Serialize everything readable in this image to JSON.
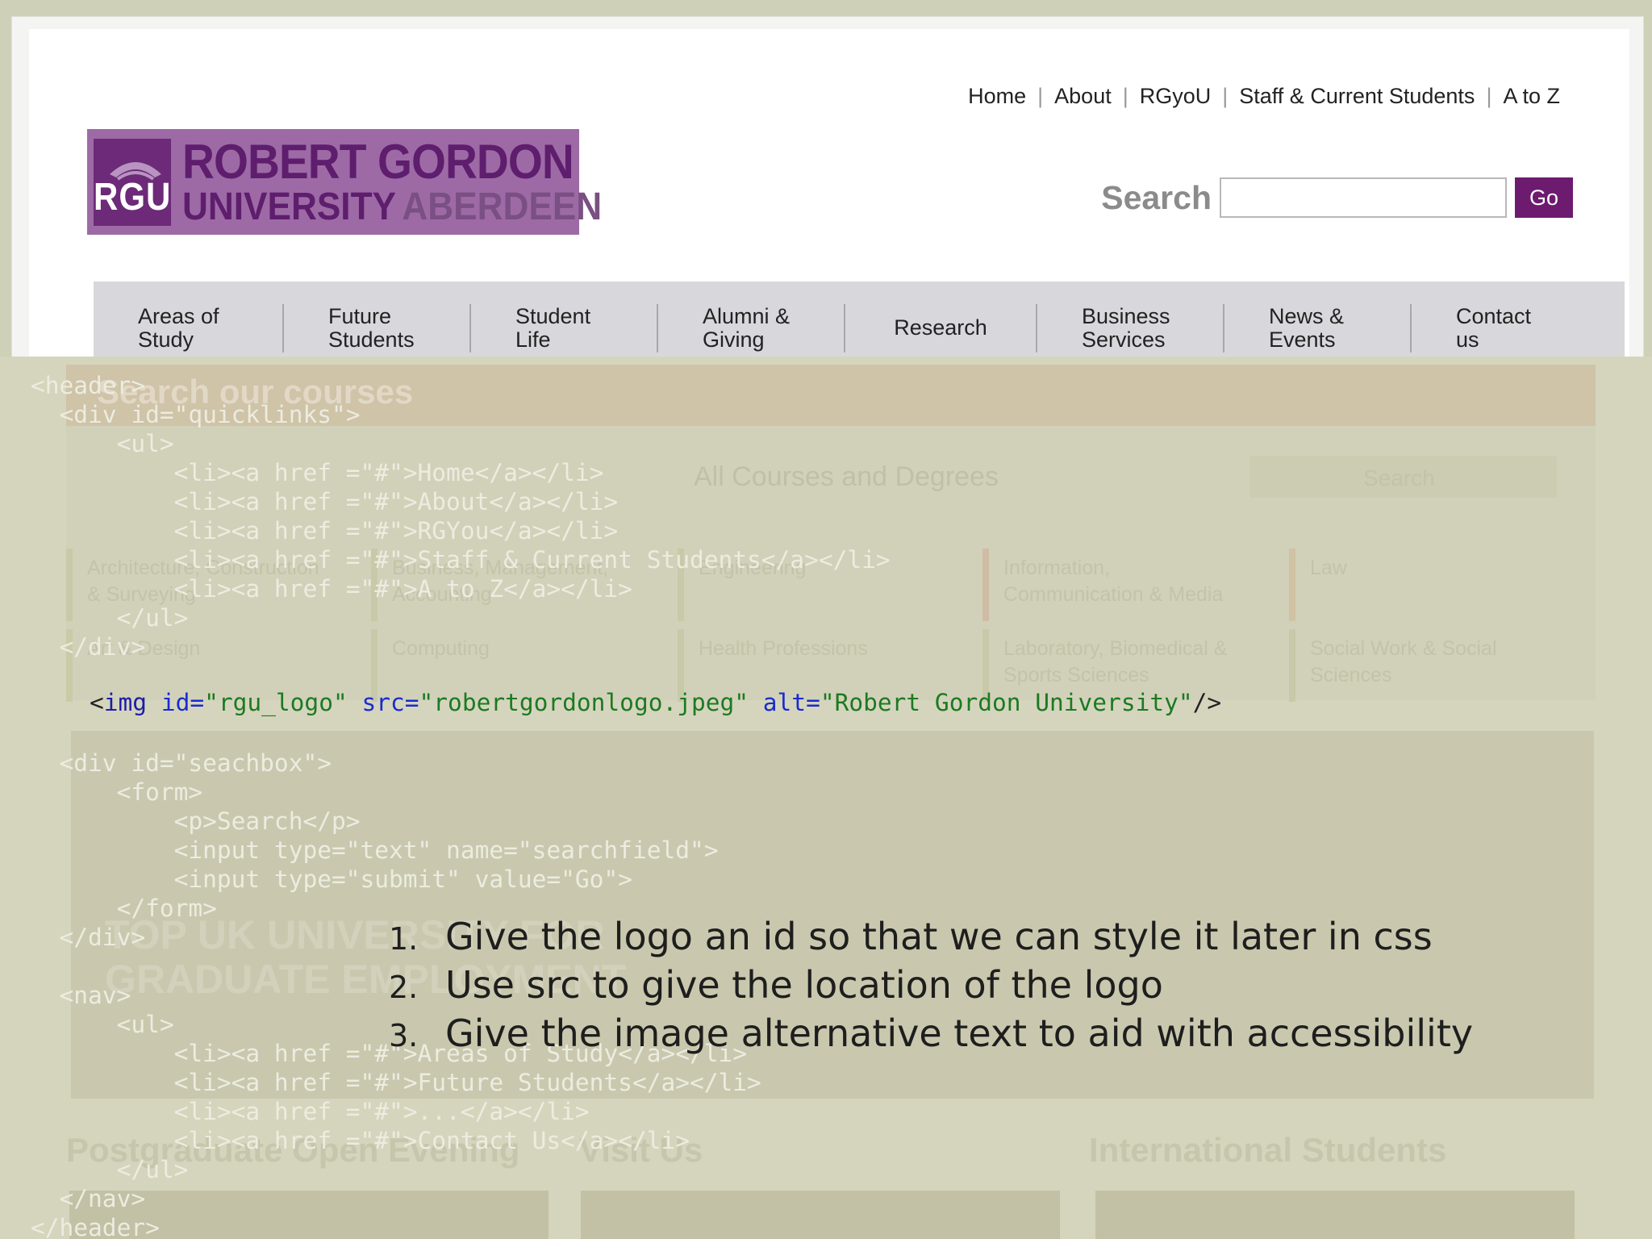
{
  "quicklinks": [
    "Home",
    "About",
    "RGyoU",
    "Staff & Current Students",
    "A to Z"
  ],
  "logo": {
    "crest": "RGU",
    "line1": "ROBERT GORDON",
    "line2a": "UNIVERSITY",
    "line2b": "ABERDEEN"
  },
  "search": {
    "label": "Search",
    "button": "Go"
  },
  "nav": [
    "Areas of\nStudy",
    "Future\nStudents",
    "Student\nLife",
    "Alumni &\nGiving",
    "Research",
    "Business\nServices",
    "News &\nEvents",
    "Contact\nus"
  ],
  "ghost": {
    "course_search_title": "Search our courses",
    "select_text": "All Courses and Degrees",
    "search_button": "Search",
    "subjects": [
      "Architecture, Construction\n& Surveying",
      "Business, Management,\nAccounting",
      "Engineering",
      "Information,\nCommunication & Media",
      "Law",
      "Art & Design",
      "Computing",
      "Health Professions",
      "Laboratory, Biomedical &\nSports Sciences",
      "Social Work & Social\nSciences"
    ],
    "hero_text": "TOP UK UNIVERSITY FOR\nGRADUATE EMPLOYMENT",
    "headings": [
      "Postgraduate Open Evening",
      "Visit Us",
      "International Students"
    ]
  },
  "code_lines": [
    "<header>",
    "  <div id=\"quicklinks\">",
    "      <ul>",
    "          <li><a href =\"#\">Home</a></li>",
    "          <li><a href =\"#\">About</a></li>",
    "          <li><a href =\"#\">RGYou</a></li>",
    "          <li><a href =\"#\">Staff & Current Students</a></li>",
    "          <li><a href =\"#\">A to Z</a></li>",
    "      </ul>",
    "  </div>",
    "",
    "",
    "",
    "  <div id=\"seachbox\">",
    "      <form>",
    "          <p>Search</p>",
    "          <input type=\"text\" name=\"searchfield\">",
    "          <input type=\"submit\" value=\"Go\">",
    "      </form>",
    "  </div>",
    "",
    "  <nav>",
    "      <ul>",
    "          <li><a href =\"#\">Areas of Study</a></li>",
    "          <li><a href =\"#\">Future Students</a></li>",
    "          <li><a href =\"#\">...</a></li>",
    "          <li><a href =\"#\">Contact Us</a></li>",
    "      </ul>",
    "  </nav>",
    "</header>"
  ],
  "img_line": {
    "open": "<",
    "tag": "img",
    "id_attr": " id=",
    "id_val": "\"rgu_logo\"",
    "src_attr": " src=",
    "src_val": "\"robertgordonlogo.jpeg\"",
    "alt_attr": " alt=",
    "alt_val": "\"Robert Gordon University\"",
    "close": "/>"
  },
  "instructions": [
    {
      "num": "1.",
      "text": "Give the logo an id so that we can style it later in css"
    },
    {
      "num": "2.",
      "text": "Use src to give the location of the logo"
    },
    {
      "num": "3.",
      "text": "Give the image alternative text to aid with accessibility"
    }
  ]
}
